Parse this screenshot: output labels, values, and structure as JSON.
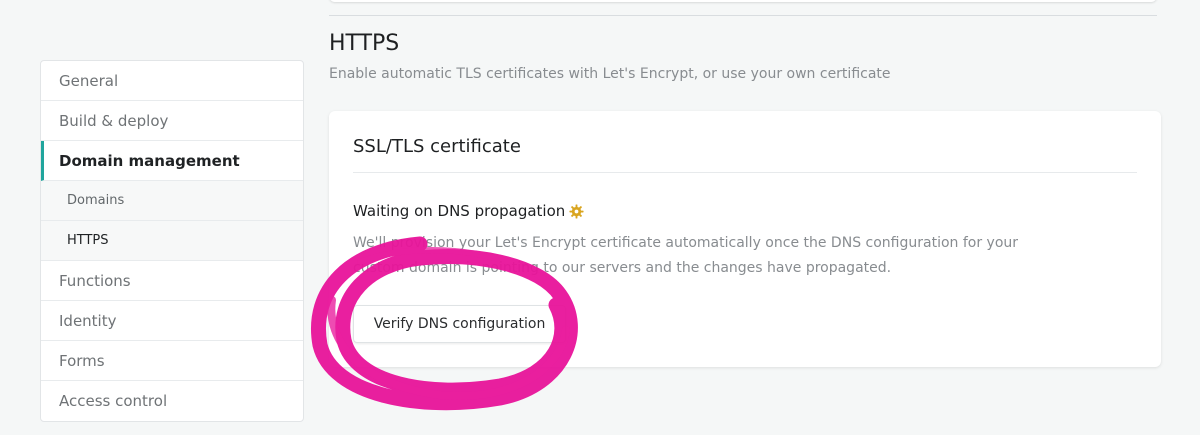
{
  "sidebar": {
    "items": [
      {
        "label": "General"
      },
      {
        "label": "Build & deploy"
      },
      {
        "label": "Domain management"
      },
      {
        "label": "Domains"
      },
      {
        "label": "HTTPS"
      },
      {
        "label": "Functions"
      },
      {
        "label": "Identity"
      },
      {
        "label": "Forms"
      },
      {
        "label": "Access control"
      }
    ]
  },
  "https": {
    "title": "HTTPS",
    "description": "Enable automatic TLS certificates with Let's Encrypt, or use your own certificate"
  },
  "card": {
    "title": "SSL/TLS certificate",
    "status": "Waiting on DNS propagation",
    "status_icon": "gear-icon",
    "text": "We'll provision your Let's Encrypt certificate automatically once the DNS configuration for your custom domain is pointing to our servers and the changes have propagated.",
    "button_label": "Verify DNS configuration"
  },
  "colors": {
    "accent": "#20a59d",
    "annotation": "#e8149a",
    "status_icon": "#d9a520"
  }
}
